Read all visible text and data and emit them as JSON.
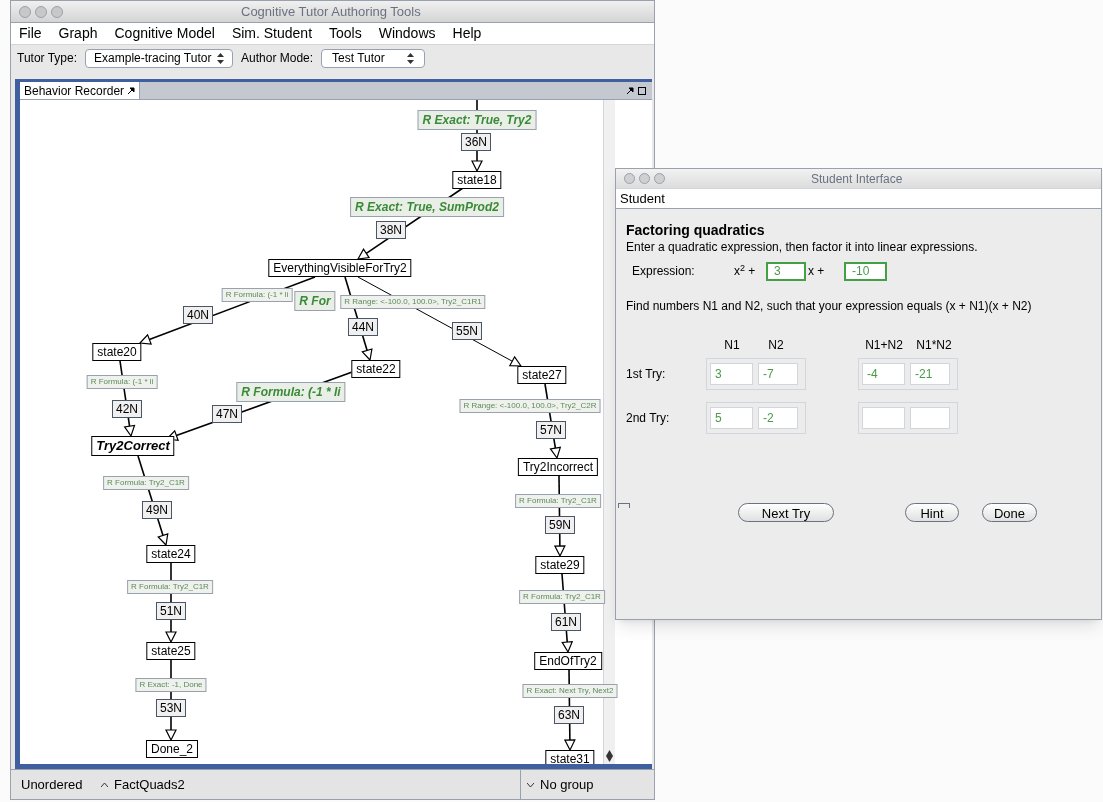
{
  "main_window": {
    "title": "Cognitive Tutor Authoring Tools",
    "menu": [
      "File",
      "Graph",
      "Cognitive Model",
      "Sim. Student",
      "Tools",
      "Windows",
      "Help"
    ],
    "toolbar": {
      "tutor_type_label": "Tutor Type:",
      "tutor_type": "Example-tracing Tutor",
      "author_mode_label": "Author Mode:",
      "author_mode": "Test Tutor"
    },
    "panel_tab": "Behavior Recorder",
    "graph": {
      "states": [
        {
          "label": "state18",
          "kind": "plain"
        },
        {
          "label": "EverythingVisibleForTry2",
          "kind": "plain"
        },
        {
          "label": "state20",
          "kind": "plain"
        },
        {
          "label": "state22",
          "kind": "plain"
        },
        {
          "label": "state27",
          "kind": "plain"
        },
        {
          "label": "Try2Correct",
          "kind": "emphasized"
        },
        {
          "label": "Try2Incorrect",
          "kind": "plain"
        },
        {
          "label": "state24",
          "kind": "plain"
        },
        {
          "label": "state29",
          "kind": "plain"
        },
        {
          "label": "state25",
          "kind": "plain"
        },
        {
          "label": "EndOfTry2",
          "kind": "plain"
        },
        {
          "label": "Done_2",
          "kind": "plain"
        },
        {
          "label": "state31",
          "kind": "plain"
        }
      ],
      "links": [
        {
          "action": "R Exact: True, Try2",
          "kind": "emphasized",
          "name": "36N"
        },
        {
          "action": "R Exact: True, SumProd2",
          "kind": "emphasized",
          "name": "38N"
        },
        {
          "action": "R Formula: (-1 * li",
          "kind": "plain",
          "name": "40N"
        },
        {
          "action": "R For",
          "kind": "emphasized",
          "name": "44N"
        },
        {
          "action": "R Range: <-100.0, 100.0>, Try2_C1R1",
          "kind": "plain",
          "name": "55N"
        },
        {
          "action": "R Formula: (-1 * li",
          "kind": "plain",
          "name": "42N"
        },
        {
          "action": "R Formula: (-1 * li",
          "kind": "emphasized",
          "name": "47N"
        },
        {
          "action": "R Range: <-100.0, 100.0>, Try2_C2R",
          "kind": "plain",
          "name": "57N"
        },
        {
          "action": "R Formula: Try2_C1R",
          "kind": "plain",
          "name": "49N"
        },
        {
          "action": "R Formula: Try2_C1R",
          "kind": "plain",
          "name": "59N"
        },
        {
          "action": "R Formula: Try2_C1R",
          "kind": "plain",
          "name": "51N"
        },
        {
          "action": "R Formula: Try2_C1R",
          "kind": "plain",
          "name": "61N"
        },
        {
          "action": "R Exact: -1, Done",
          "kind": "plain",
          "name": "53N"
        },
        {
          "action": "R Exact: Next Try, Next2",
          "kind": "plain",
          "name": "63N"
        }
      ]
    },
    "status_bar": {
      "order": "Unordered",
      "problem": "FactQuads2",
      "group": "No group"
    }
  },
  "student_window": {
    "title": "Student Interface",
    "menu": [
      "Student"
    ],
    "heading": "Factoring quadratics",
    "instructions": "Enter a quadratic expression, then factor it into linear expressions.",
    "expression": {
      "label": "Expression:",
      "term1": "x$^{2}$ +",
      "coefficient": "3",
      "term2": "x +",
      "constant": "-10"
    },
    "task": "Find numbers N1 and N2, such that your expression equals (x + N1)(x + N2)",
    "columns": [
      "N1",
      "N2",
      "N1+N2",
      "N1*N2"
    ],
    "tries": [
      {
        "label": "1st Try:",
        "values": [
          "3",
          "-7",
          "-4",
          "-21"
        ]
      },
      {
        "label": "2nd Try:",
        "values": [
          "5",
          "-2"
        ]
      }
    ],
    "buttons": [
      "Next Try",
      "Hint",
      "Done"
    ]
  }
}
